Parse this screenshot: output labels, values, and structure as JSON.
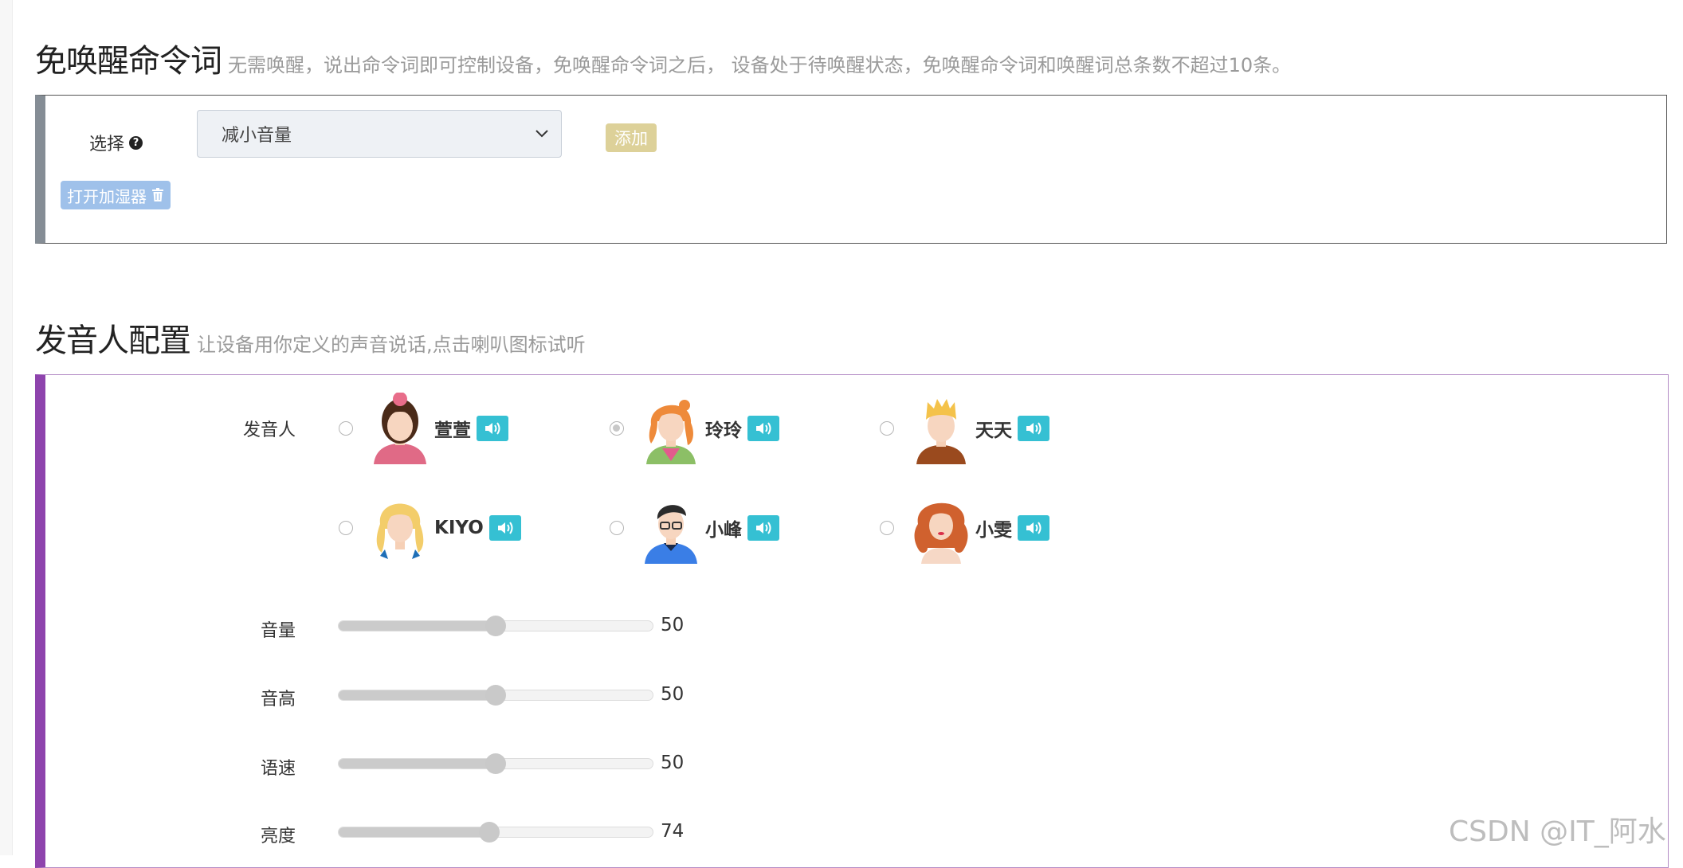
{
  "wake_free": {
    "title": "免唤醒命令词",
    "description": "无需唤醒，说出命令词即可控制设备，免唤醒命令词之后， 设备处于待唤醒状态，免唤醒命令词和唤醒词总条数不超过10条。",
    "select_label": "选择",
    "select_value": "减小音量",
    "add_label": "添加",
    "tags": [
      "打开加湿器"
    ]
  },
  "speaker_config": {
    "title": "发音人配置",
    "description": "让设备用你定义的声音说话,点击喇叭图标试听",
    "speaker_label": "发音人",
    "speakers": [
      {
        "name": "萱萱",
        "selected": false
      },
      {
        "name": "玲玲",
        "selected": true
      },
      {
        "name": "天天",
        "selected": false
      },
      {
        "name": "KIYO",
        "selected": false
      },
      {
        "name": "小峰",
        "selected": false
      },
      {
        "name": "小雯",
        "selected": false
      }
    ],
    "sliders": [
      {
        "label": "音量",
        "value": "50",
        "fraction": 0.5
      },
      {
        "label": "音高",
        "value": "50",
        "fraction": 0.5
      },
      {
        "label": "语速",
        "value": "50",
        "fraction": 0.5
      },
      {
        "label": "亮度",
        "value": "74",
        "fraction": 0.48
      }
    ]
  },
  "watermark": "CSDN @IT_阿水",
  "colors": {
    "panel1_accent": "#858d95",
    "panel2_accent": "#8e44ad",
    "add_button": "#ddd199",
    "tag": "#9fc1ea",
    "speaker_button": "#35c0d3"
  }
}
